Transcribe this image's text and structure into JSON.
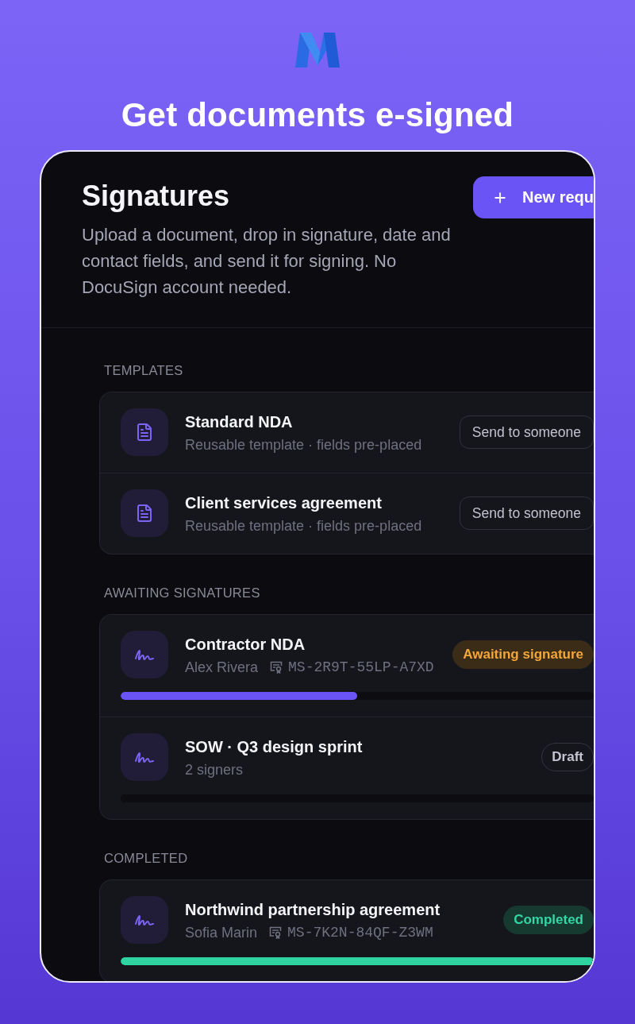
{
  "headline": "Get documents e-signed",
  "header": {
    "title": "Signatures",
    "description": "Upload a document, drop in signature, date and contact fields, and send it for signing. No DocuSign account needed.",
    "new_button": {
      "label": "New requ"
    }
  },
  "sections": [
    {
      "heading": "TEMPLATES",
      "items": [
        {
          "kind": "template",
          "title": "Standard NDA",
          "subtitle": "Reusable template · fields pre-placed",
          "action": "Send to someone"
        },
        {
          "kind": "template",
          "title": "Client services agreement",
          "subtitle": "Reusable template · fields pre-placed",
          "action": "Send to someone"
        }
      ]
    },
    {
      "heading": "AWAITING SIGNATURES",
      "items": [
        {
          "kind": "request",
          "title": "Contractor NDA",
          "meta": "Alex Rivera",
          "code": "MS-2R9T-55LP-A7XD",
          "status": {
            "kind": "awaiting",
            "label": "Awaiting signature"
          },
          "level": 0.5
        },
        {
          "kind": "request",
          "title": "SOW · Q3 design sprint",
          "meta": "2 signers",
          "status": {
            "kind": "draft",
            "label": "Draft"
          },
          "level": 0
        }
      ]
    },
    {
      "heading": "COMPLETED",
      "items": [
        {
          "kind": "request",
          "title": "Northwind partnership agreement",
          "meta": "Sofia Marin",
          "code": "MS-7K2N-84QF-Z3WM",
          "status": {
            "kind": "completed",
            "label": "Completed"
          },
          "level": 1
        }
      ]
    }
  ]
}
